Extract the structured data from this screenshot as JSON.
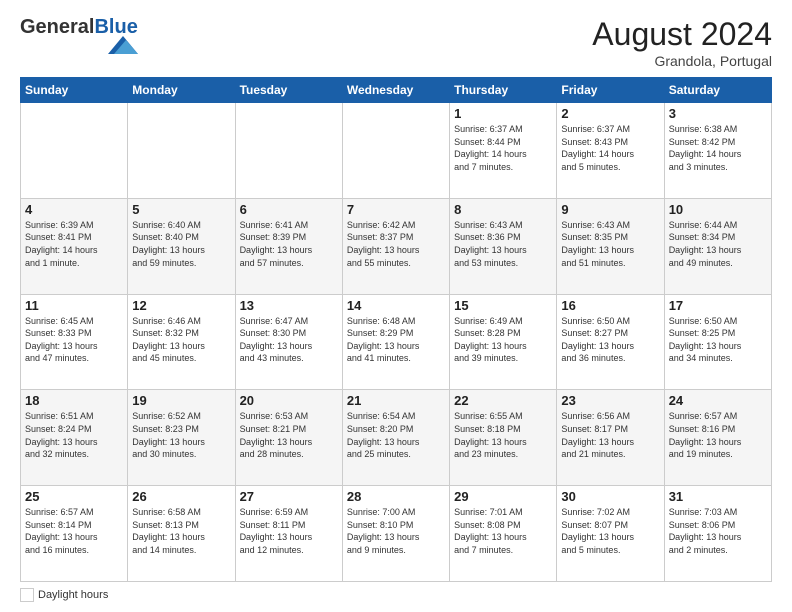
{
  "header": {
    "logo_general": "General",
    "logo_blue": "Blue",
    "month_year": "August 2024",
    "location": "Grandola, Portugal"
  },
  "weekdays": [
    "Sunday",
    "Monday",
    "Tuesday",
    "Wednesday",
    "Thursday",
    "Friday",
    "Saturday"
  ],
  "legend": {
    "white_label": "Daylight hours",
    "gray_label": ""
  },
  "weeks": [
    [
      {
        "day": "",
        "info": ""
      },
      {
        "day": "",
        "info": ""
      },
      {
        "day": "",
        "info": ""
      },
      {
        "day": "",
        "info": ""
      },
      {
        "day": "1",
        "info": "Sunrise: 6:37 AM\nSunset: 8:44 PM\nDaylight: 14 hours\nand 7 minutes."
      },
      {
        "day": "2",
        "info": "Sunrise: 6:37 AM\nSunset: 8:43 PM\nDaylight: 14 hours\nand 5 minutes."
      },
      {
        "day": "3",
        "info": "Sunrise: 6:38 AM\nSunset: 8:42 PM\nDaylight: 14 hours\nand 3 minutes."
      }
    ],
    [
      {
        "day": "4",
        "info": "Sunrise: 6:39 AM\nSunset: 8:41 PM\nDaylight: 14 hours\nand 1 minute."
      },
      {
        "day": "5",
        "info": "Sunrise: 6:40 AM\nSunset: 8:40 PM\nDaylight: 13 hours\nand 59 minutes."
      },
      {
        "day": "6",
        "info": "Sunrise: 6:41 AM\nSunset: 8:39 PM\nDaylight: 13 hours\nand 57 minutes."
      },
      {
        "day": "7",
        "info": "Sunrise: 6:42 AM\nSunset: 8:37 PM\nDaylight: 13 hours\nand 55 minutes."
      },
      {
        "day": "8",
        "info": "Sunrise: 6:43 AM\nSunset: 8:36 PM\nDaylight: 13 hours\nand 53 minutes."
      },
      {
        "day": "9",
        "info": "Sunrise: 6:43 AM\nSunset: 8:35 PM\nDaylight: 13 hours\nand 51 minutes."
      },
      {
        "day": "10",
        "info": "Sunrise: 6:44 AM\nSunset: 8:34 PM\nDaylight: 13 hours\nand 49 minutes."
      }
    ],
    [
      {
        "day": "11",
        "info": "Sunrise: 6:45 AM\nSunset: 8:33 PM\nDaylight: 13 hours\nand 47 minutes."
      },
      {
        "day": "12",
        "info": "Sunrise: 6:46 AM\nSunset: 8:32 PM\nDaylight: 13 hours\nand 45 minutes."
      },
      {
        "day": "13",
        "info": "Sunrise: 6:47 AM\nSunset: 8:30 PM\nDaylight: 13 hours\nand 43 minutes."
      },
      {
        "day": "14",
        "info": "Sunrise: 6:48 AM\nSunset: 8:29 PM\nDaylight: 13 hours\nand 41 minutes."
      },
      {
        "day": "15",
        "info": "Sunrise: 6:49 AM\nSunset: 8:28 PM\nDaylight: 13 hours\nand 39 minutes."
      },
      {
        "day": "16",
        "info": "Sunrise: 6:50 AM\nSunset: 8:27 PM\nDaylight: 13 hours\nand 36 minutes."
      },
      {
        "day": "17",
        "info": "Sunrise: 6:50 AM\nSunset: 8:25 PM\nDaylight: 13 hours\nand 34 minutes."
      }
    ],
    [
      {
        "day": "18",
        "info": "Sunrise: 6:51 AM\nSunset: 8:24 PM\nDaylight: 13 hours\nand 32 minutes."
      },
      {
        "day": "19",
        "info": "Sunrise: 6:52 AM\nSunset: 8:23 PM\nDaylight: 13 hours\nand 30 minutes."
      },
      {
        "day": "20",
        "info": "Sunrise: 6:53 AM\nSunset: 8:21 PM\nDaylight: 13 hours\nand 28 minutes."
      },
      {
        "day": "21",
        "info": "Sunrise: 6:54 AM\nSunset: 8:20 PM\nDaylight: 13 hours\nand 25 minutes."
      },
      {
        "day": "22",
        "info": "Sunrise: 6:55 AM\nSunset: 8:18 PM\nDaylight: 13 hours\nand 23 minutes."
      },
      {
        "day": "23",
        "info": "Sunrise: 6:56 AM\nSunset: 8:17 PM\nDaylight: 13 hours\nand 21 minutes."
      },
      {
        "day": "24",
        "info": "Sunrise: 6:57 AM\nSunset: 8:16 PM\nDaylight: 13 hours\nand 19 minutes."
      }
    ],
    [
      {
        "day": "25",
        "info": "Sunrise: 6:57 AM\nSunset: 8:14 PM\nDaylight: 13 hours\nand 16 minutes."
      },
      {
        "day": "26",
        "info": "Sunrise: 6:58 AM\nSunset: 8:13 PM\nDaylight: 13 hours\nand 14 minutes."
      },
      {
        "day": "27",
        "info": "Sunrise: 6:59 AM\nSunset: 8:11 PM\nDaylight: 13 hours\nand 12 minutes."
      },
      {
        "day": "28",
        "info": "Sunrise: 7:00 AM\nSunset: 8:10 PM\nDaylight: 13 hours\nand 9 minutes."
      },
      {
        "day": "29",
        "info": "Sunrise: 7:01 AM\nSunset: 8:08 PM\nDaylight: 13 hours\nand 7 minutes."
      },
      {
        "day": "30",
        "info": "Sunrise: 7:02 AM\nSunset: 8:07 PM\nDaylight: 13 hours\nand 5 minutes."
      },
      {
        "day": "31",
        "info": "Sunrise: 7:03 AM\nSunset: 8:06 PM\nDaylight: 13 hours\nand 2 minutes."
      }
    ]
  ]
}
